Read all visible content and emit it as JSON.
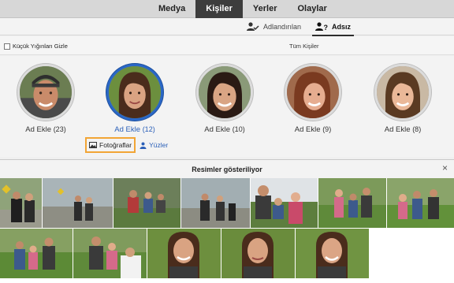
{
  "tabs": [
    "Medya",
    "Kişiler",
    "Yerler",
    "Olaylar"
  ],
  "active_tab": "Kişiler",
  "subviews": {
    "named": "Adlandırılan",
    "unnamed": "Adsız"
  },
  "options": {
    "hide_small_stacks": "Küçük Yığınları Gizle",
    "all_people": "Tüm Kişiler"
  },
  "people": [
    {
      "label": "Ad Ekle",
      "count": "(23)"
    },
    {
      "label": "Ad Ekle",
      "count": "(12)"
    },
    {
      "label": "Ad Ekle",
      "count": "(10)"
    },
    {
      "label": "Ad Ekle",
      "count": "(9)"
    },
    {
      "label": "Ad Ekle",
      "count": "(8)"
    }
  ],
  "view_buttons": {
    "photos": "Fotoğraflar",
    "faces": "Yüzler"
  },
  "panel": {
    "title": "Resimler gösteriliyor",
    "close": "×"
  },
  "colors": {
    "selection_blue": "#2a67c6",
    "active_tab_bg": "#3d3d3d",
    "highlight_orange": "#f2a535",
    "link_blue": "#2a5fb8"
  }
}
